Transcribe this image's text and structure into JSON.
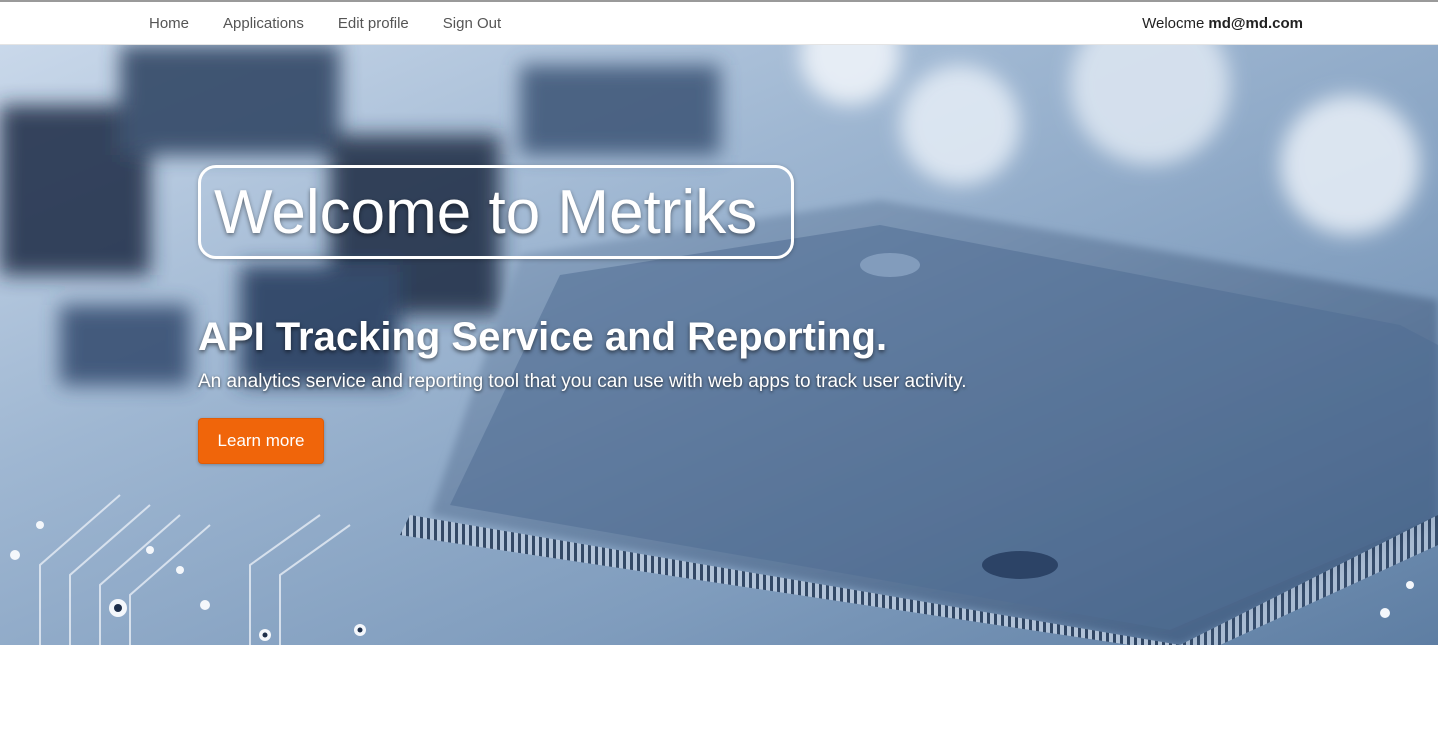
{
  "nav": {
    "links": [
      {
        "label": "Home"
      },
      {
        "label": "Applications"
      },
      {
        "label": "Edit profile"
      },
      {
        "label": "Sign Out"
      }
    ],
    "welcome_prefix": "Welocme",
    "welcome_user": "md@md.com"
  },
  "hero": {
    "title": "Welcome to Metriks",
    "subtitle": "API Tracking Service and Reporting.",
    "description": "An analytics service and reporting tool that you can use with web apps to track user activity.",
    "cta_label": "Learn more"
  },
  "colors": {
    "accent": "#f0650a",
    "hero_tint": "#8aa4c2"
  }
}
